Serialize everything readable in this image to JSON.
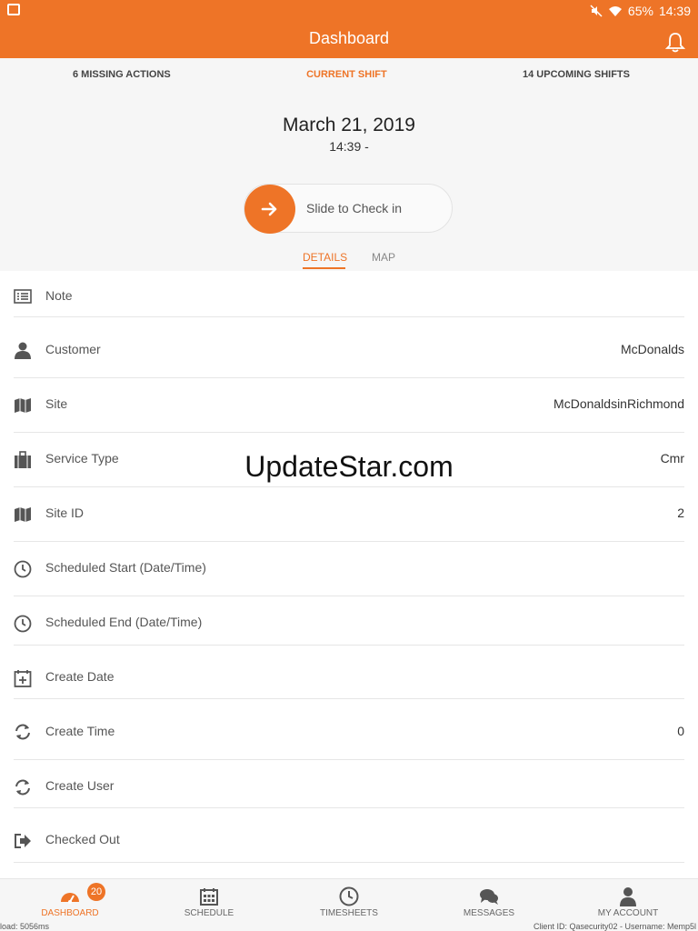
{
  "status_bar": {
    "battery": "65%",
    "time": "14:39"
  },
  "app_bar": {
    "title": "Dashboard"
  },
  "top_tabs": [
    {
      "label": "6 MISSING ACTIONS",
      "active": false
    },
    {
      "label": "CURRENT SHIFT",
      "active": true
    },
    {
      "label": "14 UPCOMING SHIFTS",
      "active": false
    }
  ],
  "shift": {
    "date": "March 21, 2019",
    "time": "14:39 -"
  },
  "slider": {
    "label": "Slide to Check in"
  },
  "sub_tabs": {
    "details": "DETAILS",
    "map": "MAP"
  },
  "rows": [
    {
      "icon": "list-icon",
      "label": "Note",
      "value": ""
    },
    {
      "icon": "person-icon",
      "label": "Customer",
      "value": "McDonalds"
    },
    {
      "icon": "map-icon",
      "label": "Site",
      "value": "McDonaldsinRichmond"
    },
    {
      "icon": "briefcase-icon",
      "label": "Service Type",
      "value": "Cmr"
    },
    {
      "icon": "map-icon",
      "label": "Site ID",
      "value": "2"
    },
    {
      "icon": "clock-icon",
      "label": "Scheduled Start (Date/Time)",
      "value": ""
    },
    {
      "icon": "clock-icon",
      "label": "Scheduled End (Date/Time)",
      "value": ""
    },
    {
      "icon": "calendar-plus-icon",
      "label": "Create Date",
      "value": ""
    },
    {
      "icon": "refresh-icon",
      "label": "Create Time",
      "value": "0"
    },
    {
      "icon": "refresh-icon",
      "label": "Create User",
      "value": ""
    },
    {
      "icon": "sign-out-icon",
      "label": "Checked Out",
      "value": ""
    }
  ],
  "watermark": "UpdateStar.com",
  "bottom_nav": [
    {
      "label": "DASHBOARD",
      "icon": "dashboard-icon",
      "active": true
    },
    {
      "label": "SCHEDULE",
      "icon": "calendar-icon",
      "active": false
    },
    {
      "label": "TIMESHEETS",
      "icon": "clock-icon",
      "active": false
    },
    {
      "label": "MESSAGES",
      "icon": "chat-icon",
      "active": false
    },
    {
      "label": "MY ACCOUNT",
      "icon": "user-icon",
      "active": false
    }
  ],
  "badge": "20",
  "debug": {
    "left": "load: 5056ms",
    "right": "Client ID: Qasecurity02 - Username: Memp5l"
  },
  "colors": {
    "accent": "#ee7427"
  }
}
